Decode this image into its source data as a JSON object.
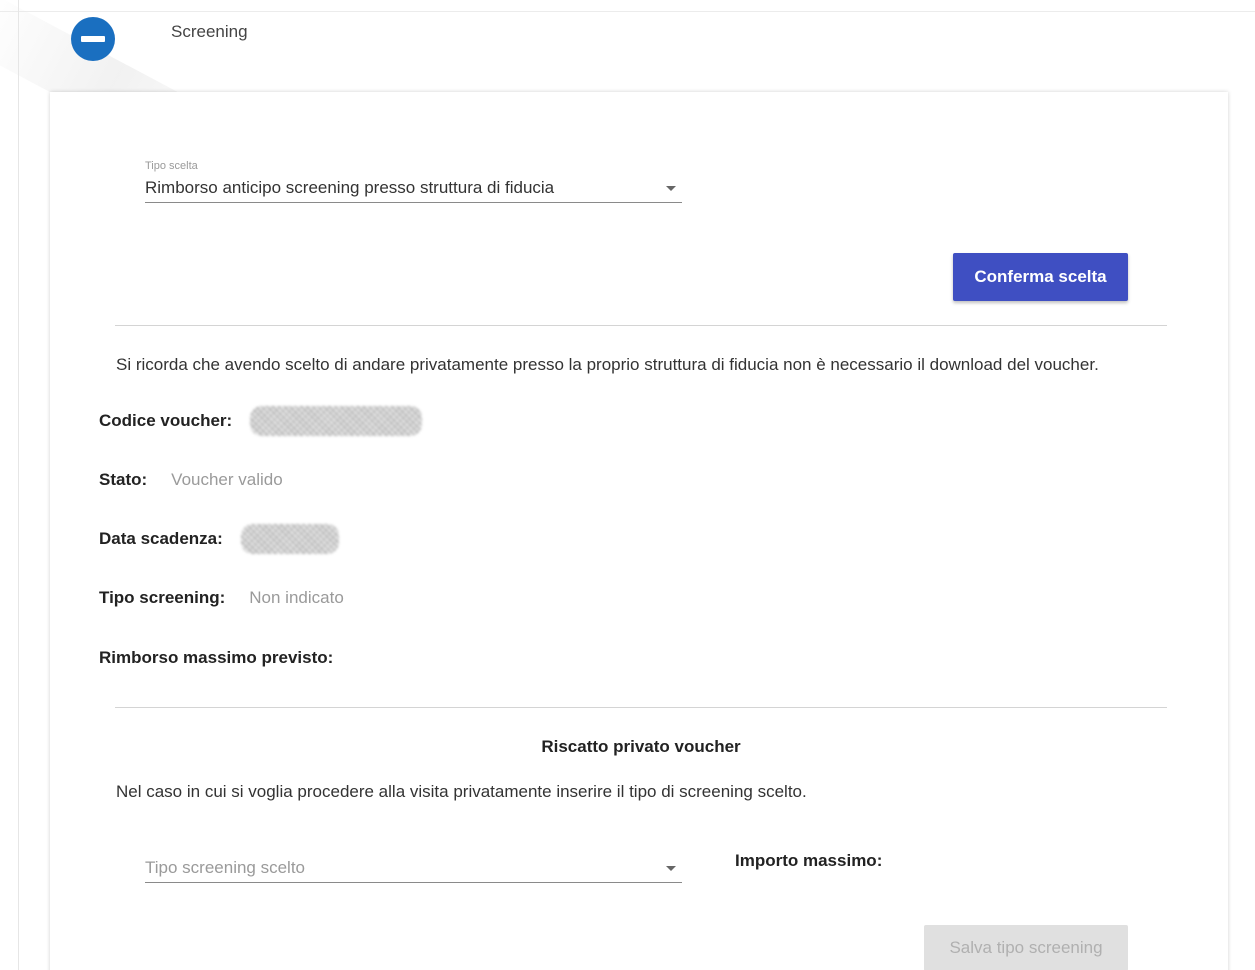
{
  "step": {
    "title": "Screening",
    "icon": "minus-circle-icon",
    "icon_color": "#1a6fc0"
  },
  "choice": {
    "label": "Tipo scelta",
    "value": "Rimborso anticipo screening presso struttura di fiducia",
    "confirm_label": "Conferma scelta"
  },
  "notice": "Si ricorda che avendo scelto di andare privatamente presso la proprio struttura di fiducia non è necessario il download del voucher.",
  "details": {
    "voucher_code_label": "Codice voucher:",
    "status_label": "Stato:",
    "status_value": "Voucher valido",
    "expiry_label": "Data scadenza:",
    "screening_type_label": "Tipo screening:",
    "screening_type_value": "Non indicato",
    "max_refund_label": "Rimborso massimo previsto:"
  },
  "private_redemption": {
    "title": "Riscatto privato voucher",
    "description": "Nel caso in cui si voglia procedere alla visita privatamente inserire il tipo di screening scelto.",
    "screening_select_placeholder": "Tipo screening scelto",
    "max_amount_label": "Importo massimo:",
    "save_label": "Salva tipo screening"
  },
  "colors": {
    "primary_button": "#3f4fc2",
    "disabled_button": "#e0e0e0"
  }
}
